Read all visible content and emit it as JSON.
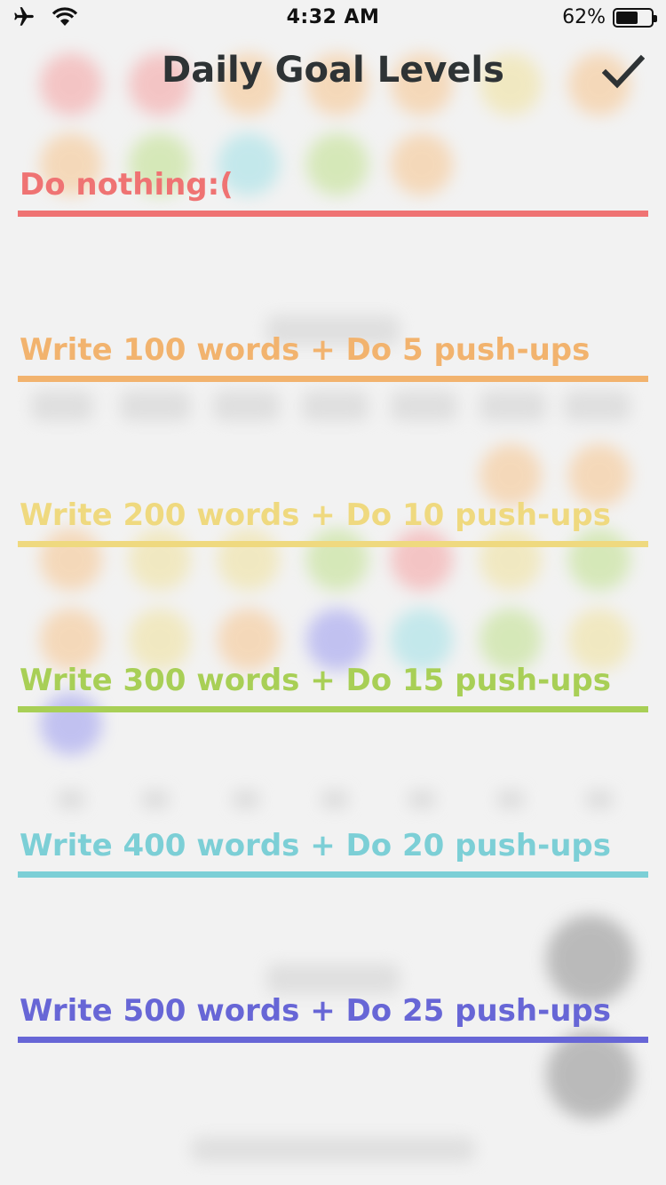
{
  "status_bar": {
    "time": "4:32 AM",
    "battery_percent": "62%",
    "battery_level": 0.62,
    "airplane_icon": "airplane-icon",
    "wifi_icon": "wifi-icon"
  },
  "header": {
    "title": "Daily Goal Levels",
    "confirm_icon": "checkmark-icon"
  },
  "levels": [
    {
      "label": "Do nothing:(",
      "color": "#ef7373"
    },
    {
      "label": "Write 100 words + Do 5 push-ups",
      "color": "#f2b36e"
    },
    {
      "label": "Write 200 words + Do 10 push-ups",
      "color": "#efd97f"
    },
    {
      "label": "Write 300 words + Do 15 push-ups",
      "color": "#a8cf56"
    },
    {
      "label": "Write 400 words + Do 20 push-ups",
      "color": "#7ccfd6"
    },
    {
      "label": "Write 500 words + Do 25 push-ups",
      "color": "#6766d6"
    }
  ]
}
